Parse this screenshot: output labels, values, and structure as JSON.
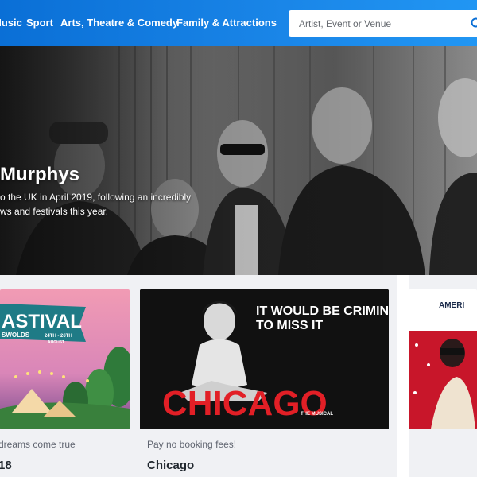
{
  "nav": {
    "items": [
      "Music",
      "Sport",
      "Arts, Theatre & Comedy",
      "Family & Attractions"
    ],
    "search_placeholder": "Artist, Event or Venue"
  },
  "hero": {
    "title": "Murphys",
    "line1": "o the UK in April 2019, following an incredibly",
    "line2": "ws and festivals this year."
  },
  "cards": [
    {
      "subtitle": "dreams come true",
      "title": "18",
      "image_text": [
        "ASTIVAL",
        "SWOLDS",
        "24TH - 26TH",
        "AUGUST"
      ]
    },
    {
      "subtitle": "Pay no booking fees!",
      "title": "Chicago",
      "image_text": [
        "IT WOULD BE CRIMINAL",
        "TO MISS IT",
        "CHICAGO",
        "THE MUSICAL"
      ]
    },
    {
      "subtitle": "",
      "title": "",
      "image_text": [
        "AMERI"
      ]
    }
  ],
  "colors": {
    "nav_start": "#0a6fd6",
    "nav_end": "#2196f3",
    "festival_teal": "#1f7b86",
    "chicago_red": "#e21f26"
  },
  "icons": {
    "search": "search-icon"
  }
}
